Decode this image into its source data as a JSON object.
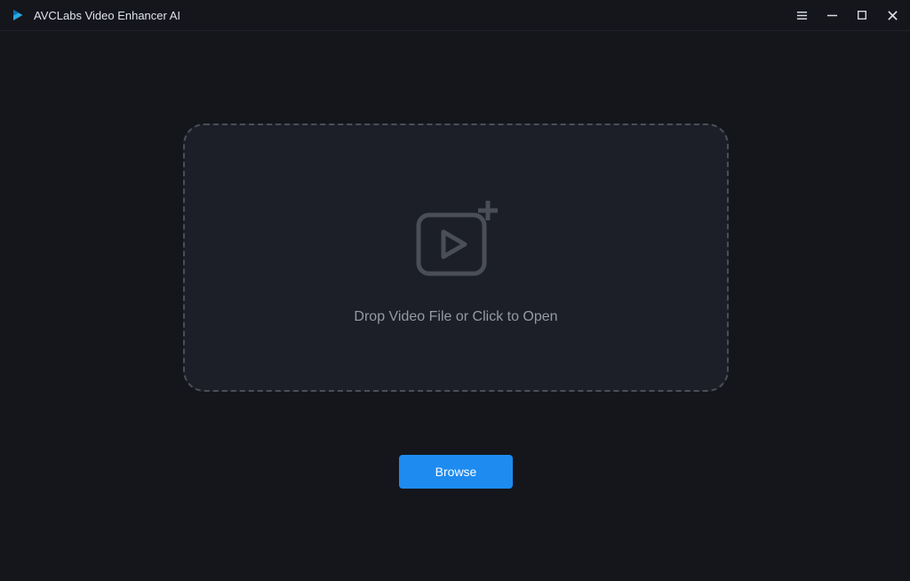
{
  "titlebar": {
    "app_title": "AVCLabs Video Enhancer AI"
  },
  "dropzone": {
    "prompt": "Drop Video File or Click to Open"
  },
  "actions": {
    "browse_label": "Browse"
  }
}
